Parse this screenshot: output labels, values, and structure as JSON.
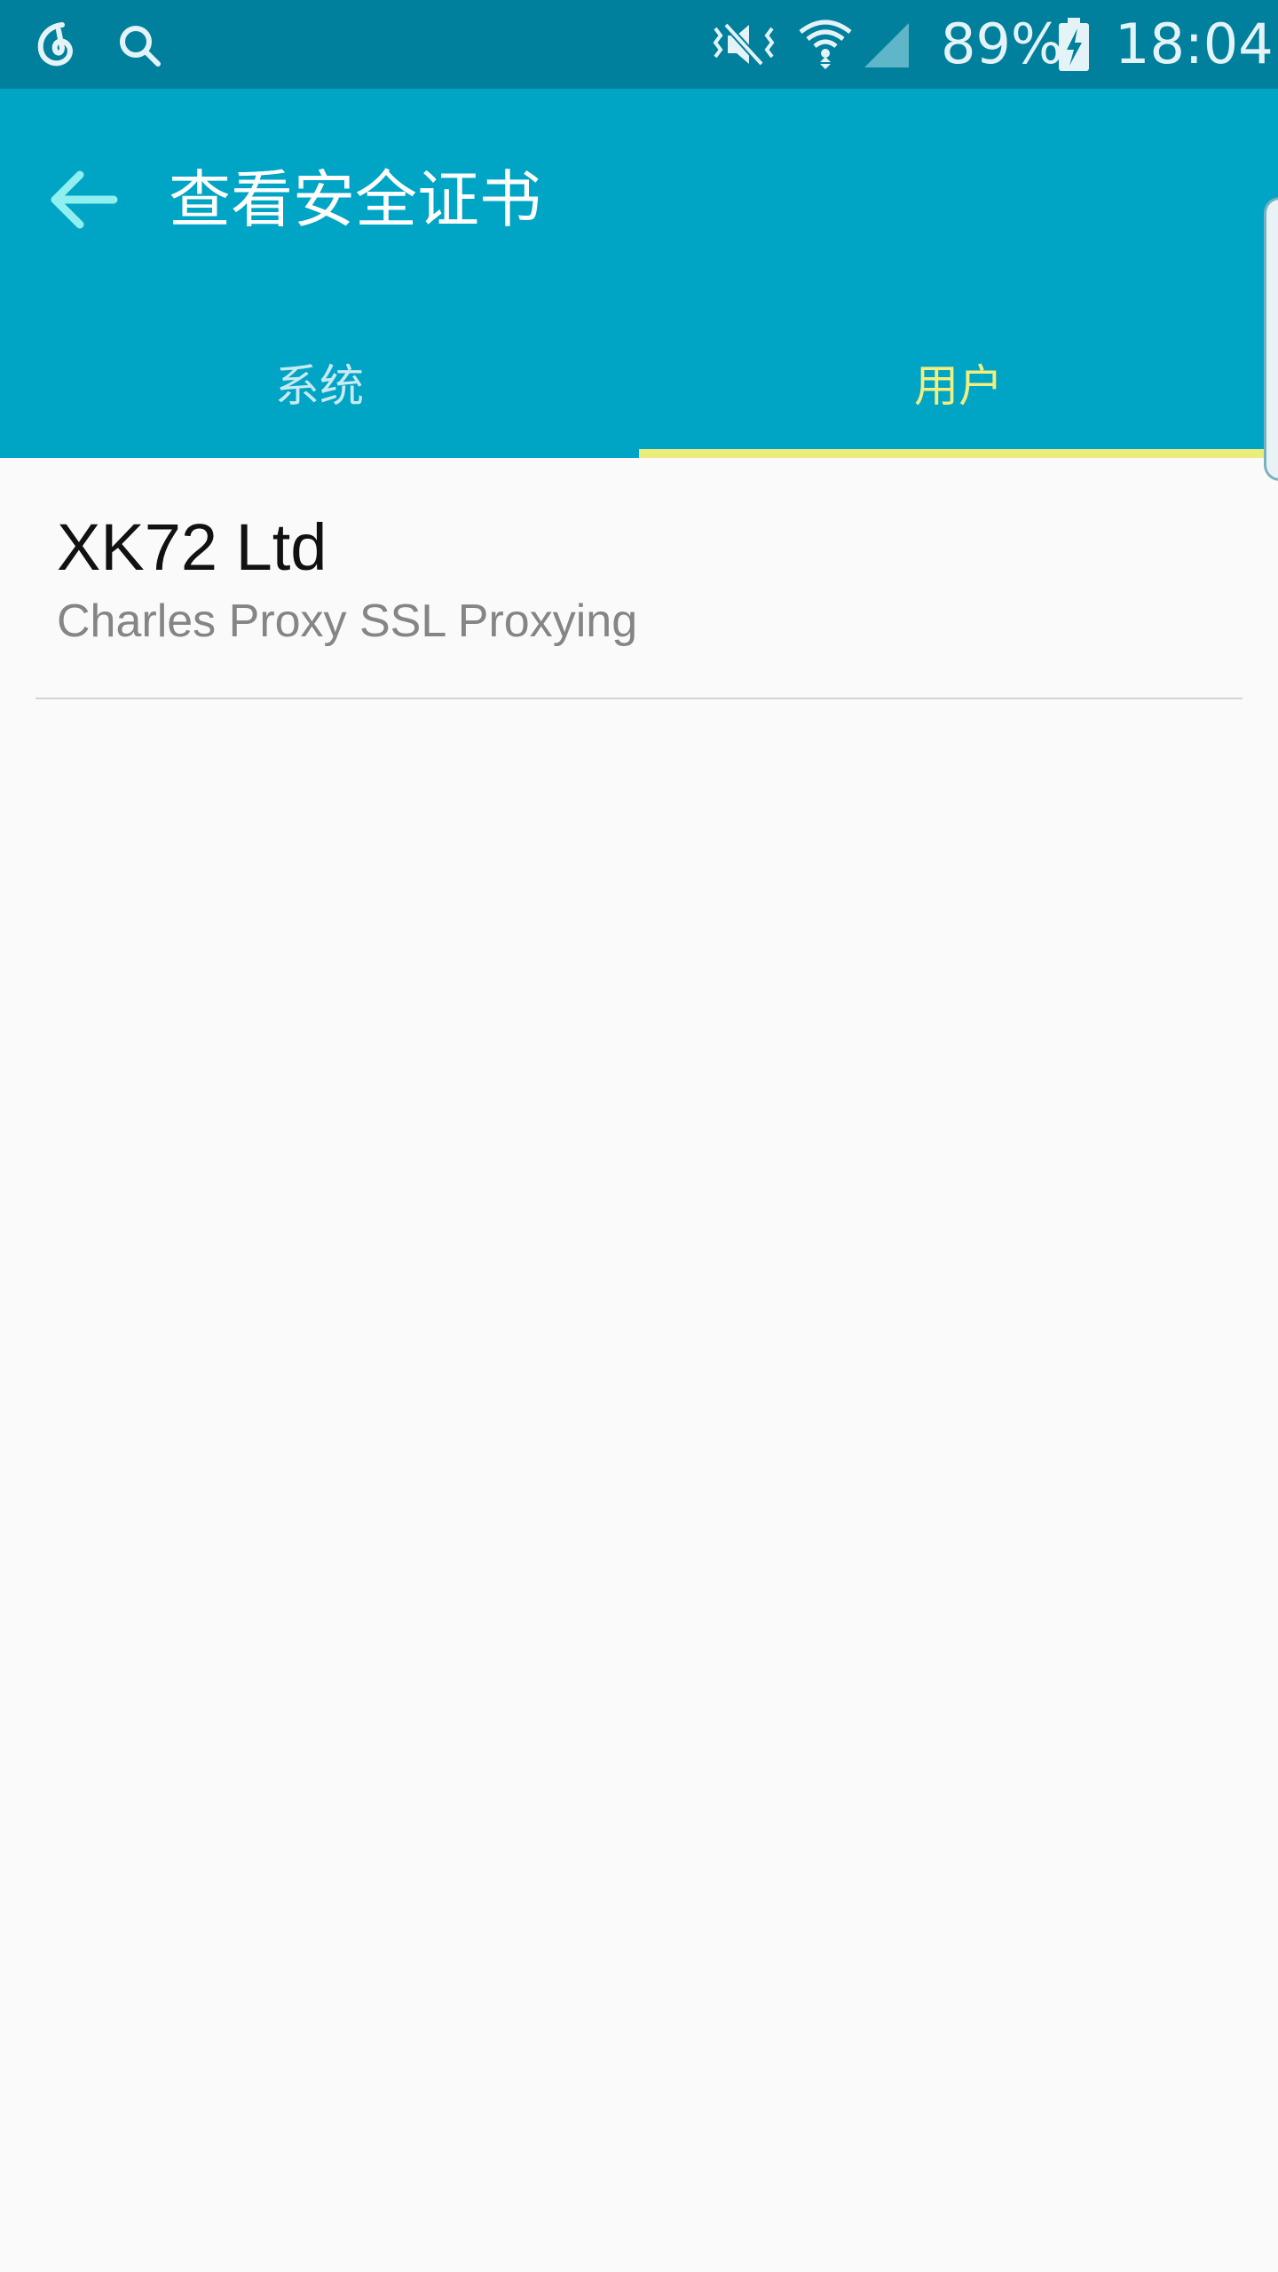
{
  "status_bar": {
    "battery_percent": "89%",
    "time": "18:04",
    "icons": [
      "netease-music-icon",
      "search-icon",
      "vibrate-mute-icon",
      "wifi-icon",
      "cell-signal-icon",
      "battery-charging-icon"
    ]
  },
  "app_bar": {
    "title": "查看安全证书",
    "back_icon": "arrow-left-icon"
  },
  "tabs": [
    {
      "label": "系统",
      "selected": false
    },
    {
      "label": "用户",
      "selected": true
    }
  ],
  "certificates": [
    {
      "title": "XK72 Ltd",
      "subtitle": "Charles Proxy SSL Proxying"
    }
  ],
  "colors": {
    "status_bar": "#00809d",
    "app_bar": "#00a4c5",
    "tab_selected": "#f2ef80",
    "tab_indicator": "#ecec7c",
    "background": "#fafafa"
  }
}
